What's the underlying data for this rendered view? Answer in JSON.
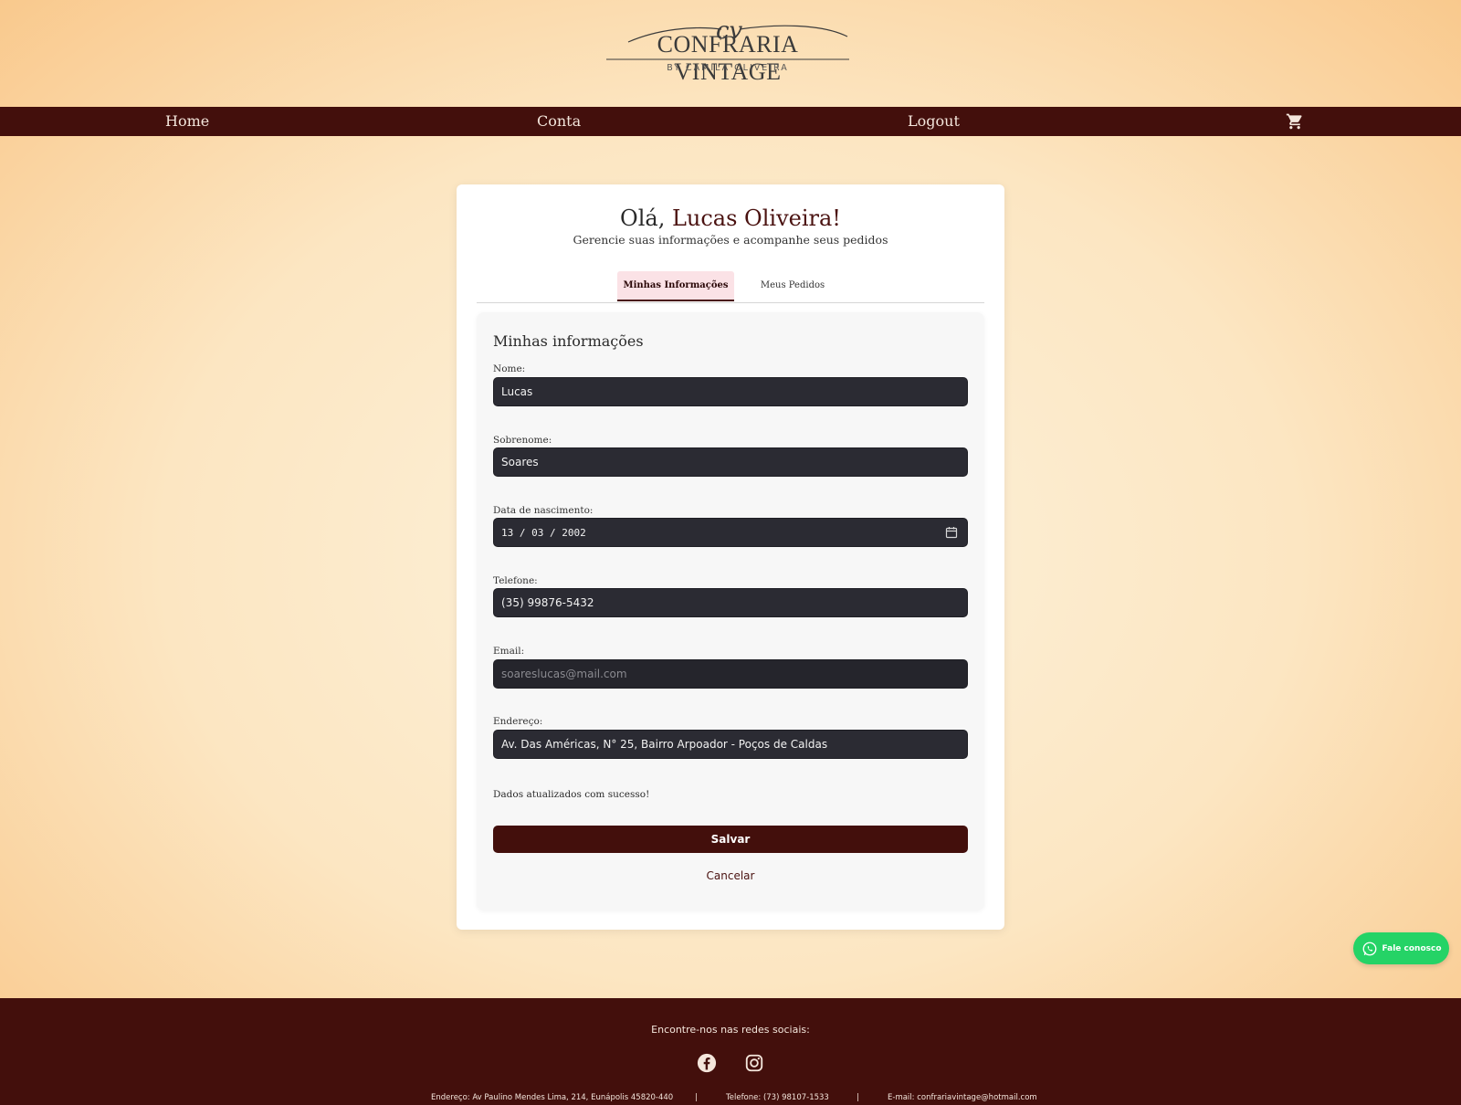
{
  "brand": {
    "name": "CONFRARIA VINTAGE",
    "byline": "BY CAMILA OLIVEIRA",
    "monogram": "cv"
  },
  "nav": {
    "home": "Home",
    "account": "Conta",
    "logout": "Logout",
    "cart_icon": "shopping-cart-icon"
  },
  "profile": {
    "greeting_prefix": "Olá, ",
    "greeting_name": "Lucas Oliveira!",
    "subtitle": "Gerencie suas informações e acompanhe seus pedidos",
    "tabs": [
      {
        "label": "Minhas Informações",
        "active": true
      },
      {
        "label": "Meus Pedidos",
        "active": false
      }
    ],
    "section_title": "Minhas informações",
    "fields": {
      "first_name": {
        "label": "Nome:",
        "value": "Lucas"
      },
      "last_name": {
        "label": "Sobrenome:",
        "value": "Soares"
      },
      "birth_date": {
        "label": "Data de nascimento:",
        "value": "13 / 03 / 2002"
      },
      "phone": {
        "label": "Telefone:",
        "value": "(35) 99876-5432"
      },
      "email": {
        "label": "Email:",
        "placeholder": "soareslucas@mail.com"
      },
      "address": {
        "label": "Endereço:",
        "value": "Av. Das Américas, N° 25, Bairro Arpoador - Poços de Caldas"
      }
    },
    "success_message": "Dados atualizados com sucesso!",
    "save_label": "Salvar",
    "cancel_label": "Cancelar"
  },
  "whatsapp": {
    "label": "Fale conosco"
  },
  "footer": {
    "social_title": "Encontre-nos nas redes sociais:",
    "address": "Endereço: Av Paulino Mendes Lima, 214, Eunápolis 45820-440",
    "separator": "|",
    "phone": "Telefone: (73) 98107-1533",
    "email": "E-mail: confrariavintage@hotmail.com"
  },
  "colors": {
    "brand_dark": "#430f0c",
    "tab_active_bg": "#fbe2e6",
    "input_bg": "#2b2b33",
    "whatsapp": "#25d366"
  }
}
